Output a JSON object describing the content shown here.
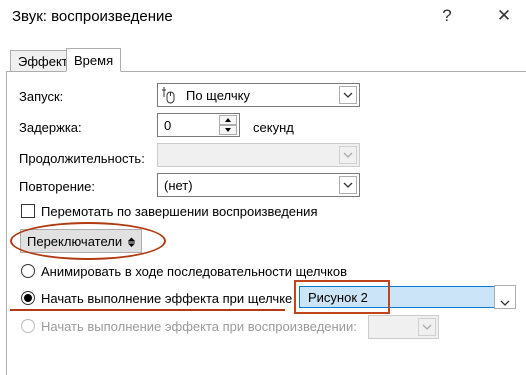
{
  "window": {
    "title": "Звук: воспроизведение",
    "help_glyph": "?",
    "close_glyph": "✕"
  },
  "tabs": [
    {
      "label": "Эффект",
      "active": false
    },
    {
      "label": "Время",
      "active": true
    }
  ],
  "timing": {
    "start_label": "Запуск:",
    "start_value": "По щелчку",
    "delay_label": "Задержка:",
    "delay_value": "0",
    "delay_unit": "секунд",
    "duration_label": "Продолжительность:",
    "duration_value": "",
    "repeat_label": "Повторение:",
    "repeat_value": "(нет)",
    "rewind_label": "Перемотать по завершении воспроизведения",
    "rewind_checked": false
  },
  "triggers": {
    "toggle_label": "Переключатели",
    "toggle_icon": "collapse-arrows-icon",
    "option_sequence": "Анимировать в ходе последовательности щелчков",
    "option_on_click": "Начать выполнение эффекта при щелчке",
    "option_on_click_target": "Рисунок 2",
    "option_on_playback": "Начать выполнение эффекта при воспроизведении:",
    "option_on_playback_value": "",
    "selected_option": "on_click"
  },
  "colors": {
    "annotation": "#b23a10",
    "selection": "#cce4f7",
    "focus_border": "#0078d7"
  }
}
